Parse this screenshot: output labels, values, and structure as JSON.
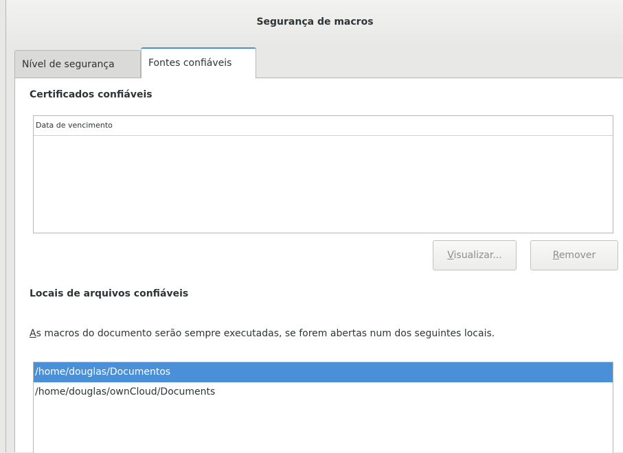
{
  "window": {
    "title": "Segurança de macros"
  },
  "tabs": [
    {
      "label": "Nível de segurança",
      "active": false
    },
    {
      "label": "Fontes confiáveis",
      "active": true
    }
  ],
  "certificates": {
    "title": "Certificados confiáveis",
    "column_header": "Data de vencimento",
    "view_button": {
      "accel": "V",
      "rest": "isualizar..."
    },
    "remove_button": {
      "accel": "R",
      "rest": "emover"
    }
  },
  "locations": {
    "title": "Locais de arquivos confiáveis",
    "description_accel": "A",
    "description_rest": "s macros do documento serão sempre executadas, se forem abertas num dos seguintes locais.",
    "items": [
      {
        "path": "/home/douglas/Documentos",
        "selected": true
      },
      {
        "path": "/home/douglas/ownCloud/Documents",
        "selected": false
      }
    ]
  },
  "colors": {
    "accent": "#4a90d9",
    "selection_text": "#ffffff"
  }
}
